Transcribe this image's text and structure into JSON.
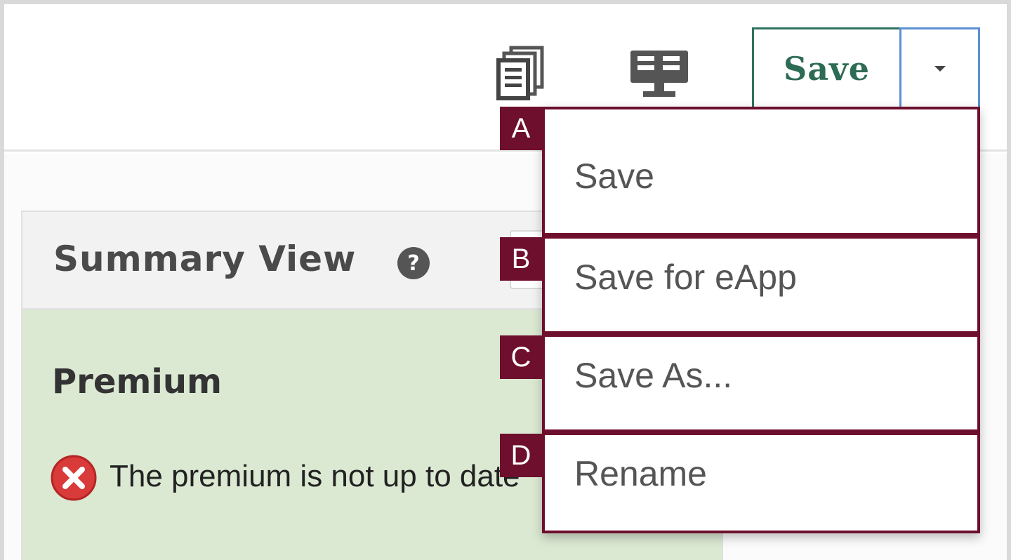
{
  "toolbar": {
    "copy_icon": "copy-pages-icon",
    "present_icon": "presentation-screen-icon",
    "save_label": "Save",
    "caret_icon": "caret-down-icon",
    "colors": {
      "save_border": "#2e7360",
      "save_text": "#2e6b55",
      "caret_border": "#5b8fd6"
    }
  },
  "dropdown": {
    "items": [
      {
        "badge": "A",
        "label": "Save"
      },
      {
        "badge": "B",
        "label": "Save for eApp"
      },
      {
        "badge": "C",
        "label": "Save As..."
      },
      {
        "badge": "D",
        "label": "Rename"
      }
    ],
    "accent_color": "#6e0f2e"
  },
  "summary": {
    "title": "Summary View",
    "help_icon": "help-question-icon",
    "section_title": "Premium",
    "error_icon": "error-x-icon",
    "error_text": "The premium is not up to date",
    "panel_color": "#dbe9d3"
  }
}
